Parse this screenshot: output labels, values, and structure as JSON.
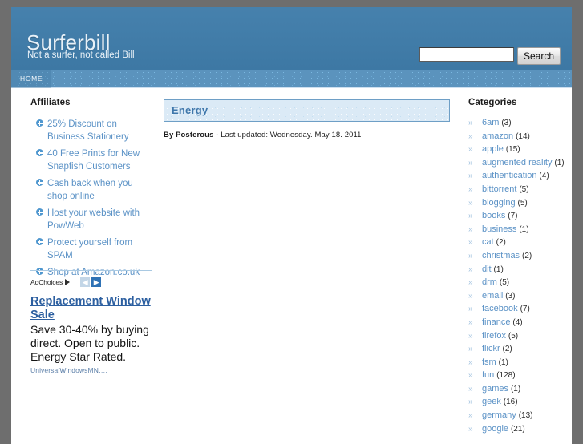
{
  "site": {
    "title": "Surferbill",
    "tagline": "Not a surfer, not called Bill"
  },
  "search": {
    "value": "",
    "placeholder": "",
    "button_label": "Search"
  },
  "nav": {
    "items": [
      {
        "label": "HOME"
      }
    ]
  },
  "sidebar_left": {
    "heading": "Affiliates",
    "items": [
      {
        "label": "25% Discount on Business Stationery"
      },
      {
        "label": " 40 Free Prints for New Snapfish Customers"
      },
      {
        "label": "Cash back when you shop online"
      },
      {
        "label": "Host your website with PowWeb"
      },
      {
        "label": "Protect yourself from SPAM"
      },
      {
        "label": "Shop at Amazon.co.uk"
      }
    ],
    "ad": {
      "adchoices_label": "AdChoices",
      "prev_label": "◀",
      "next_label": "▶",
      "title": "Replacement Window Sale",
      "body": "Save 30-40% by buying direct. Open to public. Energy Star Rated.",
      "source": "UniversalWindowsMN…."
    }
  },
  "main": {
    "post_title": "Energy",
    "meta_prefix": "By ",
    "meta_author": "Posterous",
    "meta_suffix": " - Last updated: Wednesday. May 18. 2011"
  },
  "sidebar_right": {
    "heading": "Categories",
    "items": [
      {
        "label": "6am",
        "count": "(3)"
      },
      {
        "label": "amazon",
        "count": "(14)"
      },
      {
        "label": "apple",
        "count": "(15)"
      },
      {
        "label": "augmented reality",
        "count": "(1)"
      },
      {
        "label": "authentication",
        "count": "(4)"
      },
      {
        "label": "bittorrent",
        "count": "(5)"
      },
      {
        "label": "blogging",
        "count": "(5)"
      },
      {
        "label": "books",
        "count": "(7)"
      },
      {
        "label": "business",
        "count": "(1)"
      },
      {
        "label": "cat",
        "count": "(2)"
      },
      {
        "label": "christmas",
        "count": "(2)"
      },
      {
        "label": "dit",
        "count": "(1)"
      },
      {
        "label": "drm",
        "count": "(5)"
      },
      {
        "label": "email",
        "count": "(3)"
      },
      {
        "label": "facebook",
        "count": "(7)"
      },
      {
        "label": "finance",
        "count": "(4)"
      },
      {
        "label": "firefox",
        "count": "(5)"
      },
      {
        "label": "flickr",
        "count": "(2)"
      },
      {
        "label": "fsm",
        "count": "(1)"
      },
      {
        "label": "fun",
        "count": "(128)"
      },
      {
        "label": "games",
        "count": "(1)"
      },
      {
        "label": "geek",
        "count": "(16)"
      },
      {
        "label": "germany",
        "count": "(13)"
      },
      {
        "label": "google",
        "count": "(21)"
      }
    ]
  },
  "colors": {
    "header_blue": "#3f7ba8",
    "nav_blue": "#5b93bd",
    "link_blue": "#5b92c6",
    "title_blue": "#3f77ab",
    "frame_gray": "#6e6e6e"
  }
}
